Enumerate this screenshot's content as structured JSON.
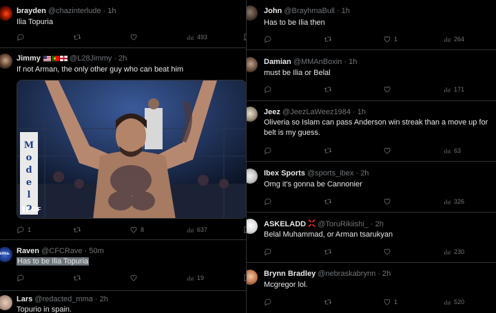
{
  "left_column": {
    "tweets": [
      {
        "name": "brayden",
        "handle": "@chazinterlude",
        "time": "1h",
        "text": "Ilia Topuria",
        "reply": "",
        "retweet": "",
        "like": "",
        "views": "493"
      },
      {
        "name": "Jimmy",
        "handle": "@L28Jimmy",
        "time": "2h",
        "text": "If not Arman, the only other guy who can beat him",
        "reply": "1",
        "retweet": "",
        "like": "8",
        "views": "637",
        "media": {
          "type": "gif",
          "badge": "GIF",
          "banner_text": "Modelo"
        }
      },
      {
        "name": "Raven",
        "handle": "@CFCRave",
        "time": "50m",
        "text": "Has to be Ilia Topuria",
        "reply": "",
        "retweet": "",
        "like": "",
        "views": "19"
      },
      {
        "name": "Lars",
        "handle": "@redacted_mma",
        "time": "2h",
        "text": "Topurio in spain."
      }
    ]
  },
  "right_column": {
    "tweets": [
      {
        "name": "John",
        "handle": "@BrayhmaBull",
        "time": "1h",
        "text": "Has to be Ilia then",
        "reply": "",
        "retweet": "",
        "like": "1",
        "views": "264"
      },
      {
        "name": "Damian",
        "handle": "@MMAnBoxin",
        "time": "1h",
        "text": "must be Ilia or Belal",
        "reply": "",
        "retweet": "",
        "like": "",
        "views": "171"
      },
      {
        "name": "Jeez",
        "handle": "@JeezLaWeez1984",
        "time": "1h",
        "text": "Oliveria so Islam can pass Anderson win streak than  a move up for belt is my guess.",
        "reply": "",
        "retweet": "",
        "like": "",
        "views": "63"
      },
      {
        "name": "Ibex Sports",
        "handle": "@sports_ibex",
        "time": "2h",
        "text": "Omg it's gonna be Cannonier",
        "reply": "",
        "retweet": "",
        "like": "",
        "views": "326"
      },
      {
        "name": "ASKELADD",
        "handle": "@ToruRikiishi_",
        "time": "2h",
        "text": "Belal Muhammad, or Arman tsarukyan",
        "reply": "",
        "retweet": "",
        "like": "",
        "views": "230"
      },
      {
        "name": "Brynn Bradley",
        "handle": "@nebraskabrynn",
        "time": "2h",
        "text": "Mcgregor lol.",
        "reply": "",
        "retweet": "",
        "like": "1",
        "views": "520"
      }
    ]
  },
  "separator": "·",
  "colors": {
    "background": "#000000",
    "text": "#e7e9ea",
    "muted": "#71767b",
    "border": "#2f3336"
  }
}
